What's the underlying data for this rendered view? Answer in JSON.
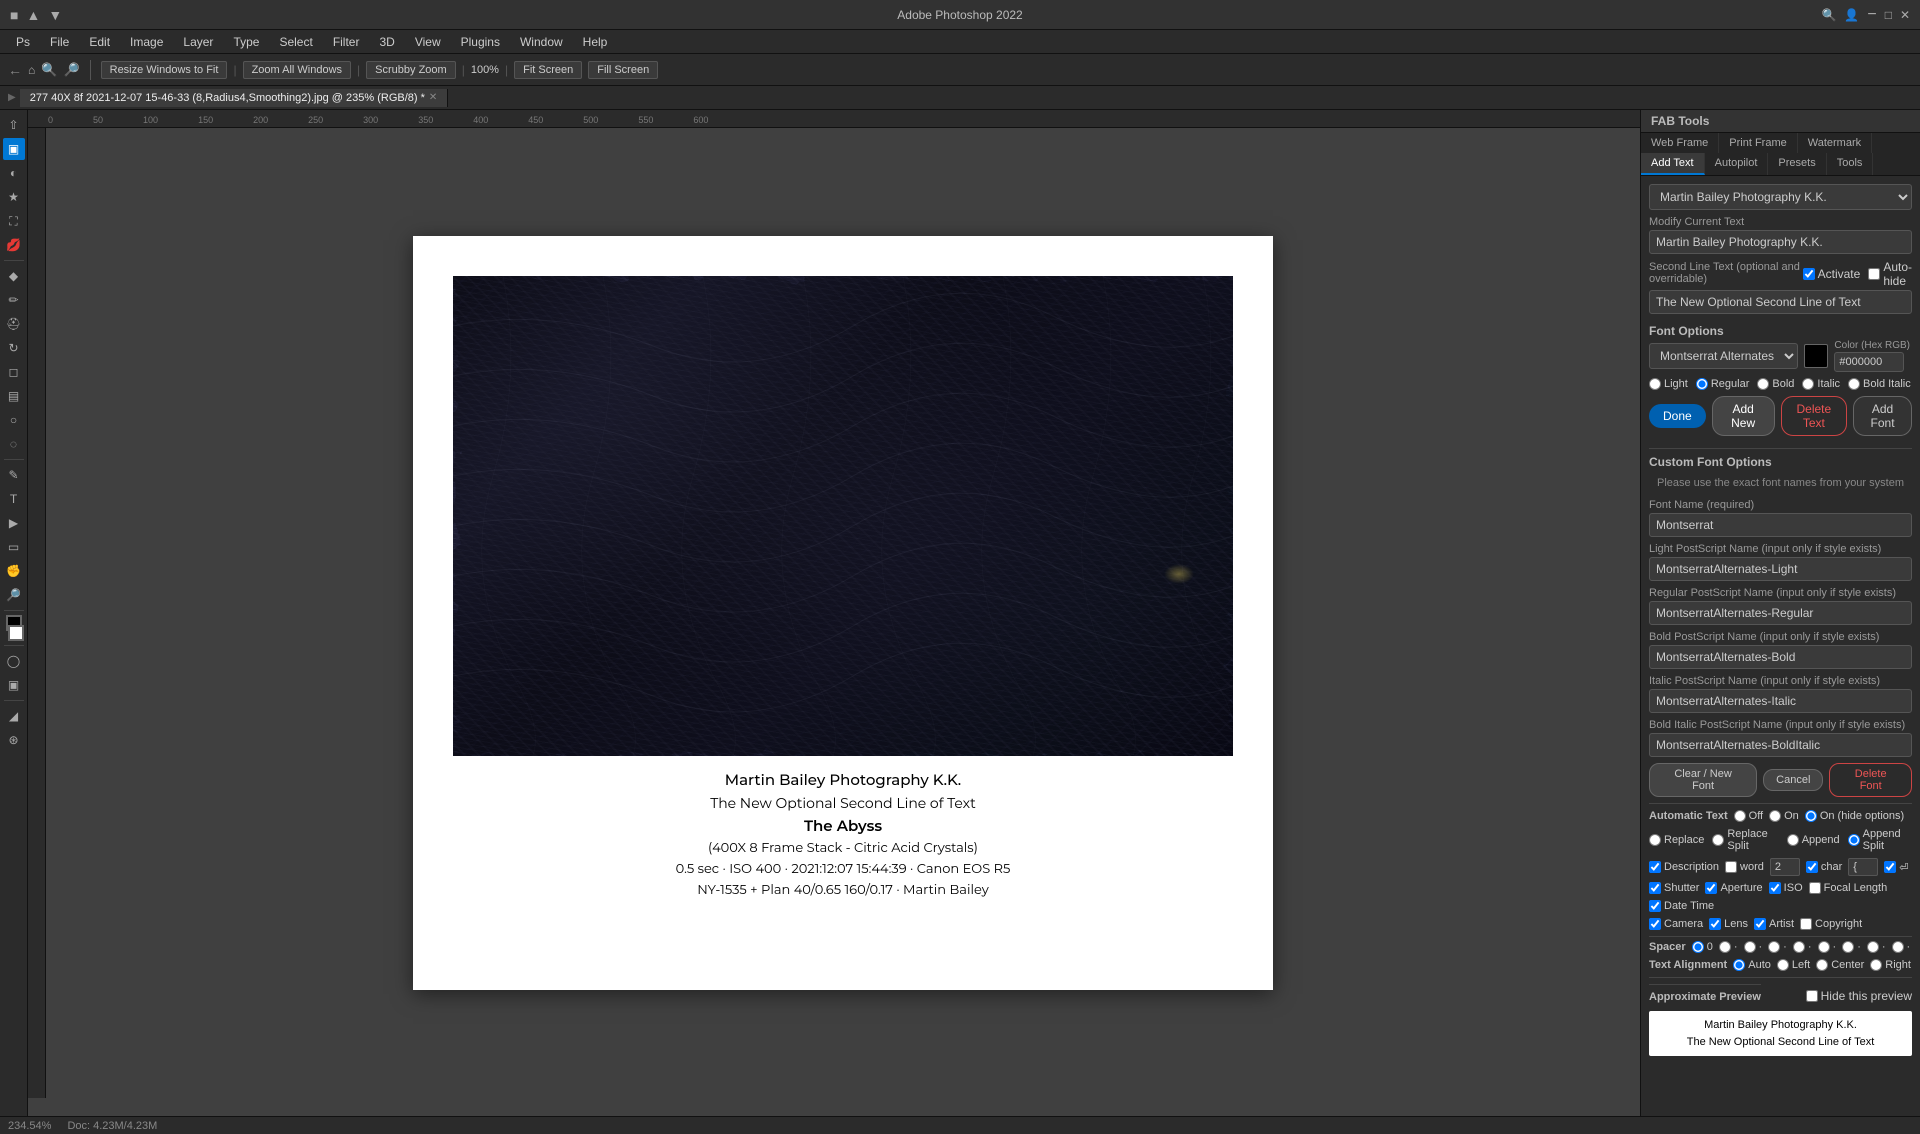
{
  "app": {
    "title": "Adobe Photoshop 2022",
    "tab_label": "277 40X 8f 2021-12-07 15-46-33 (8,Radius4,Smoothing2).jpg @ 235% (RGB/8) *",
    "zoom": "234.54%",
    "doc_size": "Doc: 4.23M/4.23M"
  },
  "toolbar": {
    "resize_btn": "Resize Windows to Fit",
    "zoom_all_btn": "Zoom All Windows",
    "scrubby_btn": "Scrubby Zoom",
    "zoom_val": "100%",
    "fit_screen_btn": "Fit Screen",
    "fill_screen_btn": "Fill Screen"
  },
  "fab_tools": {
    "header": "FAB Tools",
    "tabs": [
      "Web Frame",
      "Print Frame",
      "Watermark",
      "Add Text",
      "Autopilot",
      "Presets",
      "Tools"
    ],
    "active_tab": "Add Text",
    "preset_select": "Martin Bailey Photography K.K.",
    "modify_current_label": "Modify Current Text",
    "modify_current_value": "Martin Bailey Photography K.K.",
    "second_line_label": "Second Line Text (optional and overridable)",
    "second_line_value": "The New Optional Second Line of Text",
    "activate_label": "Activate",
    "auto_hide_label": "Auto-hide",
    "font_options_label": "Font Options",
    "font_name": "Montserrat Alternates",
    "color_label": "Color (Hex RGB)",
    "color_hex": "#000000",
    "styles": {
      "light": "Light",
      "regular": "Regular",
      "bold": "Bold",
      "italic": "Italic",
      "bold_italic": "Bold Italic"
    },
    "buttons": {
      "done": "Done",
      "add_new": "Add New",
      "delete_text": "Delete Text",
      "add_font": "Add Font"
    },
    "custom_font_header": "Custom Font Options",
    "custom_font_note": "Please use the exact font names from your system",
    "font_name_label": "Font Name (required)",
    "font_name_value": "Montserrat",
    "light_ps_label": "Light PostScript Name (input only if style exists)",
    "light_ps_value": "MontserratAlternates-Light",
    "regular_ps_label": "Regular PostScript Name (input only if style exists)",
    "regular_ps_value": "MontserratAlternates-Regular",
    "bold_ps_label": "Bold PostScript Name (input only if style exists)",
    "bold_ps_value": "MontserratAlternates-Bold",
    "italic_ps_label": "Italic PostScript Name (input only if style exists)",
    "italic_ps_value": "MontserratAlternates-Italic",
    "bold_italic_ps_label": "Bold Italic PostScript Name (input only if style exists)",
    "bold_italic_ps_value": "MontserratAlternates-BoldItalic",
    "clear_new_font_btn": "Clear / New Font",
    "cancel_btn": "Cancel",
    "delete_font_btn": "Delete Font",
    "auto_text_label": "Automatic Text",
    "auto_off": "Off",
    "auto_on": "On",
    "auto_on_hide": "On (hide options)",
    "replace_label": "Replace",
    "replace_split_label": "Replace Split",
    "append_label": "Append",
    "append_split_label": "Append Split",
    "description_label": "Description",
    "word_label": "word",
    "word_count": "2",
    "char_label": "char",
    "char_value": "{",
    "shutter_label": "Shutter",
    "aperture_label": "Aperture",
    "iso_label": "ISO",
    "focal_length_label": "Focal Length",
    "date_time_label": "Date Time",
    "camera_label": "Camera",
    "lens_label": "Lens",
    "artist_label": "Artist",
    "copyright_label": "Copyright",
    "spacer_label": "Spacer",
    "spacer_value": "0",
    "text_alignment_label": "Text Alignment",
    "align_auto": "Auto",
    "align_left": "Left",
    "align_center": "Center",
    "align_right": "Right",
    "approx_preview_label": "Approximate Preview",
    "hide_preview_label": "Hide this preview",
    "preview_line1": "Martin Bailey Photography K.K.",
    "preview_line2": "The New Optional Second Line of Text"
  },
  "caption": {
    "line1": "Martin Bailey Photography K.K.",
    "line2": "The New Optional Second Line of Text",
    "line3": "The Abyss",
    "line4": "(400X 8 Frame Stack - Citric Acid Crystals)",
    "line5": "0.5 sec · ISO 400 · 2021:12:07 15:44:39 · Canon EOS R5",
    "line6": "NY-1535 + Plan 40/0.65 160/0.17 · Martin Bailey"
  }
}
